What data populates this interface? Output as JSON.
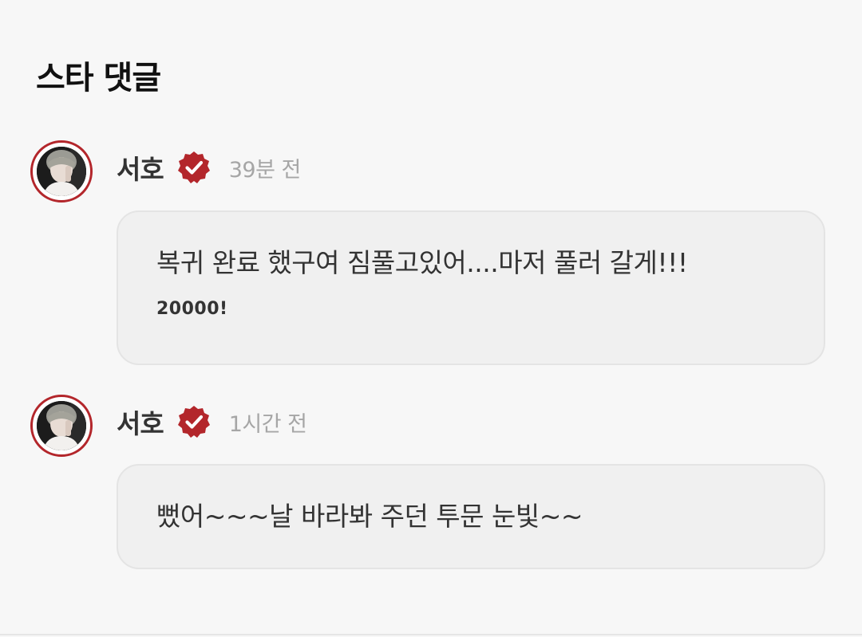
{
  "section": {
    "title": "스타 댓글"
  },
  "comments": [
    {
      "username": "서호",
      "timestamp": "39분 전",
      "text_line_1": "복귀 완료 했구여 짐풀고있어....마저 풀러 갈게!!!",
      "text_line_2": "20000!"
    },
    {
      "username": "서호",
      "timestamp": "1시간 전",
      "text_line_1": "뻤어~~~날 바라봐 주던 투문 눈빛~~"
    }
  ],
  "colors": {
    "accent": "#b3262b",
    "background": "#f7f7f7",
    "bubble": "#f0f0f0",
    "timestamp": "#a6a6a6"
  },
  "icons": {
    "verified": "verified-badge-icon",
    "avatar": "profile-photo"
  }
}
